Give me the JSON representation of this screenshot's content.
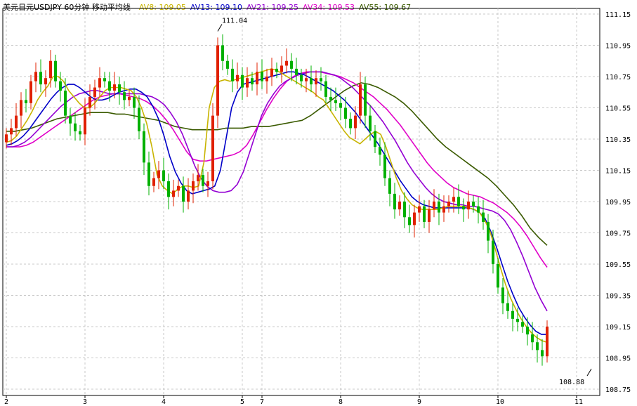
{
  "chart_data": {
    "type": "candlestick",
    "title": "美元日元USDJPY 60分钟 移动平均线",
    "legend": [
      {
        "label": "AV8:",
        "value": "109.05",
        "color": "#c8b400"
      },
      {
        "label": "AV13:",
        "value": "109.10",
        "color": "#0000c8"
      },
      {
        "label": "AV21:",
        "value": "109.25",
        "color": "#9400d3"
      },
      {
        "label": "AV34:",
        "value": "109.53",
        "color": "#e000c8"
      },
      {
        "label": "AV55:",
        "value": "109.67",
        "color": "#3a5a00"
      }
    ],
    "ylim": [
      108.75,
      111.15
    ],
    "y_ticks": [
      "111.15",
      "110.95",
      "110.75",
      "110.55",
      "110.35",
      "110.15",
      "109.95",
      "109.75",
      "109.55",
      "109.35",
      "109.15",
      "108.95",
      "108.75"
    ],
    "x_ticks": [
      {
        "label": "2",
        "bar": 0
      },
      {
        "label": "3",
        "bar": 16
      },
      {
        "label": "4",
        "bar": 32
      },
      {
        "label": "5",
        "bar": 48
      },
      {
        "label": "7",
        "bar": 52
      },
      {
        "label": "8",
        "bar": 68
      },
      {
        "label": "9",
        "bar": 84
      },
      {
        "label": "10",
        "bar": 100
      },
      {
        "label": "11",
        "bar": 116
      }
    ],
    "annotations": [
      {
        "text": "111.04",
        "bar": 43,
        "value": 111.04
      },
      {
        "text": "108.88",
        "bar": 119,
        "value": 108.88
      }
    ],
    "up_color": "#e02000",
    "down_color": "#00b000",
    "closes": [
      110.38,
      110.42,
      110.5,
      110.6,
      110.58,
      110.72,
      110.78,
      110.7,
      110.74,
      110.85,
      110.72,
      110.66,
      110.5,
      110.45,
      110.4,
      110.38,
      110.55,
      110.62,
      110.68,
      110.74,
      110.72,
      110.66,
      110.7,
      110.65,
      110.6,
      110.62,
      110.55,
      110.4,
      110.2,
      110.05,
      110.1,
      110.15,
      110.08,
      109.98,
      110.02,
      110.05,
      109.95,
      110.02,
      110.08,
      110.12,
      110.05,
      110.08,
      110.5,
      110.95,
      110.85,
      110.8,
      110.72,
      110.76,
      110.68,
      110.74,
      110.7,
      110.78,
      110.72,
      110.75,
      110.8,
      110.78,
      110.82,
      110.85,
      110.8,
      110.76,
      110.72,
      110.74,
      110.7,
      110.74,
      110.72,
      110.62,
      110.6,
      110.58,
      110.55,
      110.48,
      110.42,
      110.5,
      110.7,
      110.5,
      110.4,
      110.3,
      110.25,
      110.1,
      110.0,
      109.9,
      109.95,
      109.85,
      109.8,
      109.88,
      109.92,
      109.82,
      109.9,
      109.95,
      109.88,
      109.92,
      109.95,
      109.98,
      109.92,
      109.9,
      109.95,
      109.92,
      109.88,
      109.82,
      109.7,
      109.55,
      109.4,
      109.3,
      109.25,
      109.2,
      109.18,
      109.15,
      109.1,
      109.05,
      109.0,
      108.96,
      109.15
    ],
    "av8": [
      110.33,
      110.34,
      110.37,
      110.42,
      110.47,
      110.53,
      110.6,
      110.65,
      110.69,
      110.75,
      110.75,
      110.72,
      110.66,
      110.62,
      110.58,
      110.55,
      110.55,
      110.58,
      110.62,
      110.66,
      110.68,
      110.68,
      110.68,
      110.67,
      110.66,
      110.62,
      110.55,
      110.45,
      110.3,
      110.12,
      110.05,
      110.02,
      110.0,
      110.03,
      110.05,
      110.05,
      110.04,
      110.05,
      110.2,
      110.55,
      110.68,
      110.72,
      110.73,
      110.72,
      110.73,
      110.74,
      110.75,
      110.76,
      110.77,
      110.78,
      110.79,
      110.8,
      110.79,
      110.77,
      110.75,
      110.73,
      110.71,
      110.69,
      110.67,
      110.65,
      110.62,
      110.6,
      110.55,
      110.5,
      110.45,
      110.4,
      110.36,
      110.34,
      110.32,
      110.35,
      110.38,
      110.4,
      110.38,
      110.3,
      110.2,
      110.1,
      110.02,
      109.97,
      109.93,
      109.91,
      109.9,
      109.9,
      109.9,
      109.9,
      109.91,
      109.92,
      109.92,
      109.92,
      109.92,
      109.91,
      109.9,
      109.88,
      109.83,
      109.76,
      109.65,
      109.53,
      109.42,
      109.33,
      109.26,
      109.2,
      109.15,
      109.11,
      109.08,
      109.06,
      109.05
    ],
    "av13": [
      110.31,
      110.32,
      110.34,
      110.37,
      110.41,
      110.46,
      110.51,
      110.56,
      110.61,
      110.65,
      110.68,
      110.7,
      110.7,
      110.68,
      110.65,
      110.62,
      110.6,
      110.6,
      110.61,
      110.63,
      110.65,
      110.66,
      110.67,
      110.67,
      110.65,
      110.62,
      110.56,
      110.48,
      110.37,
      110.24,
      110.14,
      110.07,
      110.02,
      110.0,
      110.01,
      110.02,
      110.03,
      110.05,
      110.15,
      110.35,
      110.55,
      110.65,
      110.7,
      110.71,
      110.72,
      110.73,
      110.74,
      110.75,
      110.76,
      110.77,
      110.78,
      110.78,
      110.77,
      110.76,
      110.74,
      110.72,
      110.7,
      110.68,
      110.66,
      110.63,
      110.6,
      110.56,
      110.52,
      110.47,
      110.42,
      110.37,
      110.32,
      110.26,
      110.2,
      110.14,
      110.08,
      110.03,
      109.98,
      109.95,
      109.93,
      109.92,
      109.91,
      109.91,
      109.91,
      109.91,
      109.91,
      109.91,
      109.91,
      109.9,
      109.88,
      109.84,
      109.76,
      109.66,
      109.55,
      109.44,
      109.35,
      109.27,
      109.21,
      109.16,
      109.12,
      109.1,
      109.1
    ],
    "av21": [
      110.3,
      110.3,
      110.31,
      110.33,
      110.36,
      110.4,
      110.44,
      110.48,
      110.52,
      110.56,
      110.59,
      110.62,
      110.64,
      110.65,
      110.66,
      110.66,
      110.65,
      110.64,
      110.64,
      110.64,
      110.64,
      110.64,
      110.64,
      110.63,
      110.62,
      110.6,
      110.57,
      110.52,
      110.46,
      110.38,
      110.28,
      110.18,
      110.1,
      110.05,
      110.02,
      110.01,
      110.01,
      110.02,
      110.06,
      110.14,
      110.26,
      110.38,
      110.5,
      110.58,
      110.64,
      110.69,
      110.72,
      110.74,
      110.76,
      110.77,
      110.78,
      110.78,
      110.78,
      110.77,
      110.76,
      110.74,
      110.71,
      110.68,
      110.64,
      110.6,
      110.56,
      110.51,
      110.46,
      110.4,
      110.34,
      110.27,
      110.2,
      110.14,
      110.09,
      110.04,
      110.0,
      109.97,
      109.95,
      109.94,
      109.93,
      109.93,
      109.92,
      109.92,
      109.91,
      109.9,
      109.89,
      109.87,
      109.83,
      109.77,
      109.69,
      109.6,
      109.5,
      109.4,
      109.32,
      109.25
    ],
    "av34": [
      110.3,
      110.3,
      110.3,
      110.31,
      110.33,
      110.36,
      110.39,
      110.42,
      110.45,
      110.48,
      110.51,
      110.54,
      110.57,
      110.6,
      110.62,
      110.63,
      110.64,
      110.64,
      110.63,
      110.62,
      110.61,
      110.59,
      110.56,
      110.52,
      110.47,
      110.41,
      110.34,
      110.27,
      110.22,
      110.21,
      110.21,
      110.22,
      110.23,
      110.24,
      110.25,
      110.27,
      110.31,
      110.38,
      110.46,
      110.54,
      110.61,
      110.67,
      110.72,
      110.75,
      110.77,
      110.78,
      110.78,
      110.78,
      110.77,
      110.76,
      110.75,
      110.73,
      110.71,
      110.68,
      110.65,
      110.62,
      110.58,
      110.54,
      110.49,
      110.44,
      110.38,
      110.32,
      110.26,
      110.2,
      110.15,
      110.11,
      110.07,
      110.04,
      110.02,
      110.0,
      109.99,
      109.98,
      109.96,
      109.94,
      109.91,
      109.88,
      109.84,
      109.79,
      109.73,
      109.66,
      109.59,
      109.53
    ],
    "av55": [
      110.4,
      110.4,
      110.41,
      110.42,
      110.44,
      110.46,
      110.48,
      110.49,
      110.5,
      110.51,
      110.52,
      110.52,
      110.52,
      110.51,
      110.51,
      110.5,
      110.49,
      110.48,
      110.47,
      110.45,
      110.43,
      110.42,
      110.41,
      110.41,
      110.41,
      110.41,
      110.42,
      110.42,
      110.42,
      110.43,
      110.43,
      110.43,
      110.44,
      110.45,
      110.46,
      110.47,
      110.5,
      110.54,
      110.58,
      110.62,
      110.66,
      110.69,
      110.71,
      110.7,
      110.68,
      110.65,
      110.62,
      110.58,
      110.53,
      110.47,
      110.41,
      110.35,
      110.3,
      110.26,
      110.22,
      110.18,
      110.14,
      110.1,
      110.05,
      109.99,
      109.93,
      109.86,
      109.78,
      109.72,
      109.67
    ]
  }
}
